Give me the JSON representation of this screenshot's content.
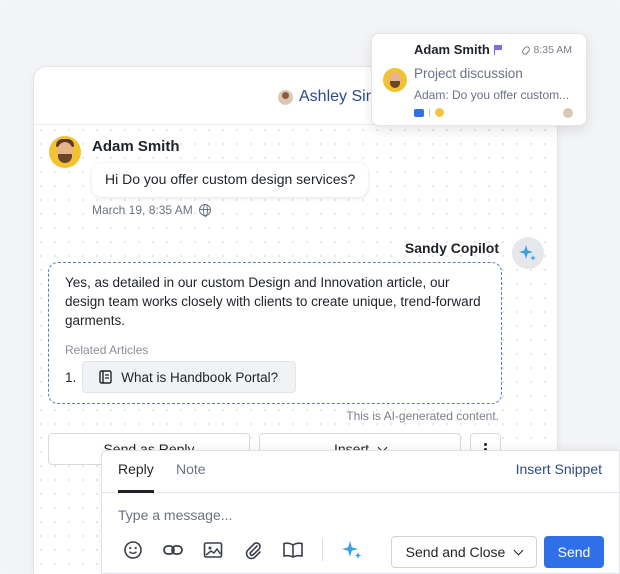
{
  "header": {
    "agent_name": "Ashley Simp"
  },
  "conversation": {
    "customer": {
      "name": "Adam Smith",
      "message": "Hi Do you offer custom design services?",
      "timestamp": "March 19, 8:35 AM"
    },
    "copilot": {
      "name": "Sandy Copilot",
      "response": "Yes, as detailed in our custom Design and Innovation article, our design team works closely with clients to create unique, trend-forward garments.",
      "related_label": "Related Articles",
      "articles": [
        {
          "number": "1.",
          "title": "What is Handbook Portal?"
        }
      ],
      "ai_note": "This is AI-generated content.",
      "actions": {
        "send_as_reply": "Send as Reply",
        "insert": "Insert"
      }
    }
  },
  "notification": {
    "name": "Adam Smith",
    "time": "8:35 AM",
    "subject": "Project discussion",
    "preview": "Adam: Do you offer custom..."
  },
  "composer": {
    "tabs": [
      "Reply",
      "Note"
    ],
    "insert_snippet": "Insert Snippet",
    "placeholder": "Type a message...",
    "send_and_close": "Send and Close",
    "send": "Send"
  },
  "colors": {
    "accent": "#2f6fe8",
    "dashed_border": "#4f81c7",
    "flag": "#7b6ee0",
    "link": "#2c4a8a"
  },
  "icons": [
    "globe-icon",
    "sparkle-icon",
    "book-icon",
    "chevron-down-icon",
    "more-vertical-icon",
    "flag-icon",
    "paperclip-icon",
    "chat-icon",
    "emoji-icon",
    "link-icon",
    "image-icon",
    "attachment-icon",
    "knowledge-base-icon"
  ]
}
